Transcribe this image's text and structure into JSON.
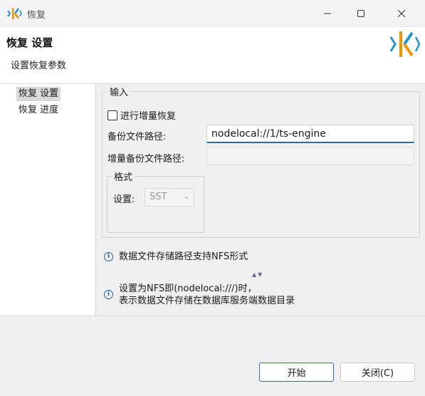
{
  "window": {
    "title": "恢复"
  },
  "header": {
    "title": "恢复 设置",
    "subtitle": "设置恢复参数"
  },
  "sidebar": {
    "items": [
      {
        "label": "恢复 设置"
      },
      {
        "label": "恢复 进度"
      }
    ]
  },
  "input_group": {
    "legend": "输入",
    "incremental_checkbox": {
      "label": "进行增量恢复",
      "checked": false
    },
    "backup_path": {
      "label": "备份文件路径:",
      "value": "nodelocal://1/ts-engine"
    },
    "incremental_path": {
      "label": "增量备份文件路径:",
      "value": ""
    },
    "format": {
      "legend": "格式",
      "setting_label": "设置:",
      "selected": "SST"
    }
  },
  "info": {
    "line1": "数据文件存储路径支持NFS形式",
    "line2a": "设置为NFS即(nodelocal:///)时，",
    "line2b": "表示数据文件存储在数据库服务端数据目录"
  },
  "footer": {
    "start_button": "开始",
    "close_button": "关闭(C)"
  },
  "colors": {
    "accent": "#2f6db5",
    "info": "#1b5ea8",
    "logo_orange": "#f39200",
    "logo_blue": "#1f8fd6"
  }
}
